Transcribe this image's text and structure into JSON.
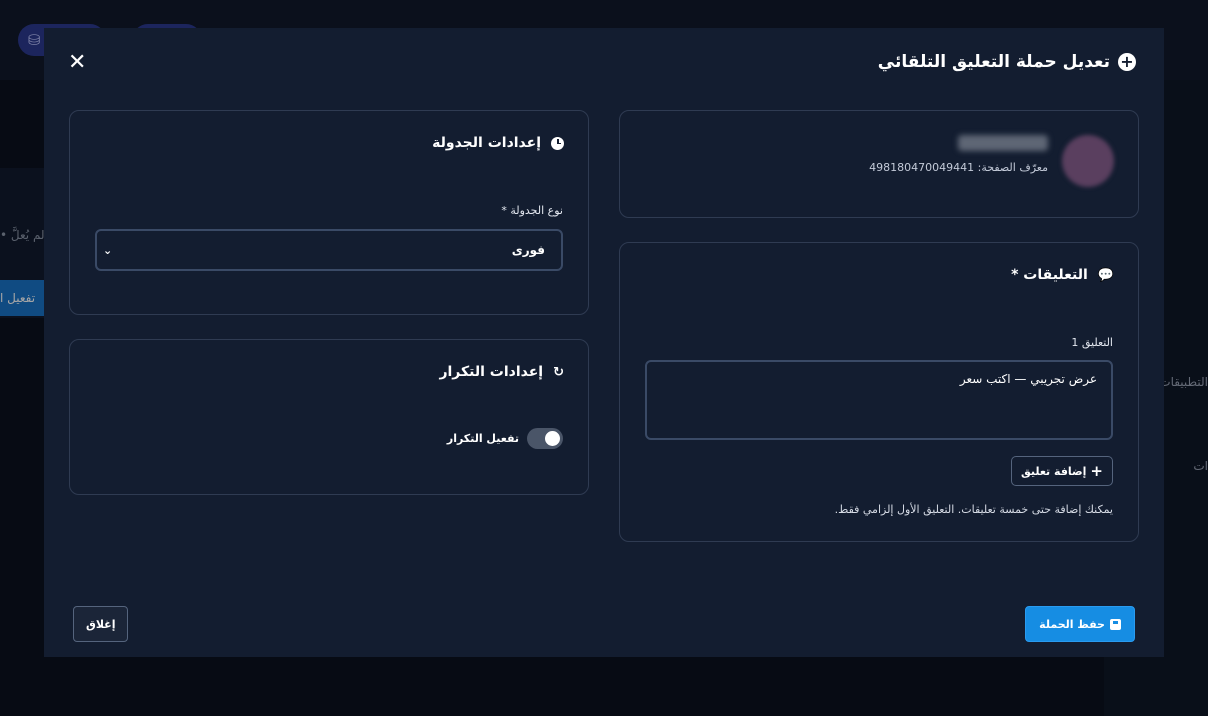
{
  "background": {
    "left_note": "• لم يُعلَّ",
    "left_button": "تفعيل ا",
    "right_item_1": "التطبيقات",
    "right_item_2": "ات"
  },
  "modal": {
    "title": "تعديل حملة التعليق التلقائي",
    "close_icon": "✕"
  },
  "page_card": {
    "page_id_label": "معرّف الصفحة:",
    "page_id_value": "498180470049441"
  },
  "comments_card": {
    "title": "التعليقات *",
    "comment_1_label": "التعليق 1",
    "comment_1_value": "عرض تجريبي — اكتب سعر",
    "add_button_label": "إضافة تعليق",
    "help_text": "يمكنك إضافة حتى خمسة تعليقات. التعليق الأول إلزامي فقط."
  },
  "schedule_card": {
    "title": "إعدادات الجدولة",
    "schedule_type_label": "نوع الجدولة *",
    "schedule_type_value": "فورى"
  },
  "repeat_card": {
    "title": "إعدادات التكرار",
    "toggle_label": "تفعيل التكرار",
    "toggle_on": true
  },
  "footer": {
    "save_label": "حفظ الحملة",
    "close_label": "إغلاق"
  },
  "colors": {
    "accent": "#168de3",
    "modal_bg": "#131d30",
    "border": "#2f3b52"
  }
}
